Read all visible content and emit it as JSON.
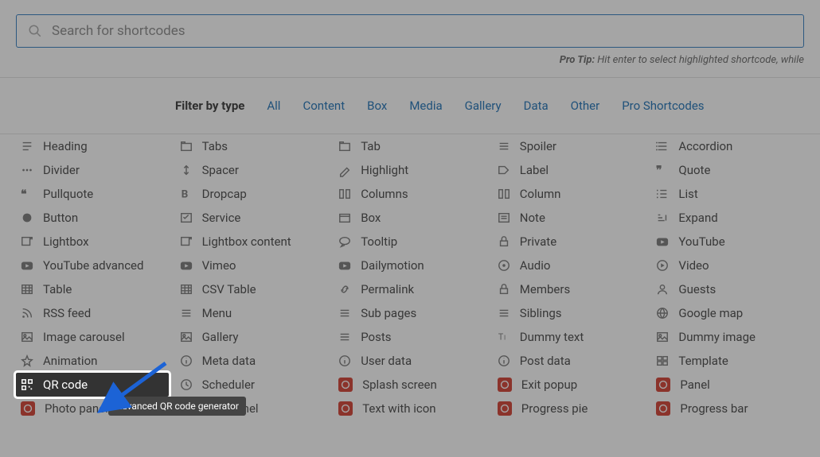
{
  "search": {
    "placeholder": "Search for shortcodes"
  },
  "protip": {
    "label": "Pro Tip:",
    "text": " Hit enter to select highlighted shortcode, while "
  },
  "filter": {
    "label": "Filter by type",
    "links": [
      "All",
      "Content",
      "Box",
      "Media",
      "Gallery",
      "Data",
      "Other",
      "Pro Shortcodes"
    ]
  },
  "tooltip": "Advanced QR code generator",
  "items": [
    {
      "icon": "heading",
      "label": "Heading"
    },
    {
      "icon": "tabs",
      "label": "Tabs"
    },
    {
      "icon": "tab",
      "label": "Tab"
    },
    {
      "icon": "spoiler",
      "label": "Spoiler"
    },
    {
      "icon": "accordion",
      "label": "Accordion"
    },
    {
      "icon": "divider",
      "label": "Divider"
    },
    {
      "icon": "spacer",
      "label": "Spacer"
    },
    {
      "icon": "highlight",
      "label": "Highlight"
    },
    {
      "icon": "label",
      "label": "Label"
    },
    {
      "icon": "quote",
      "label": "Quote"
    },
    {
      "icon": "pullquote",
      "label": "Pullquote"
    },
    {
      "icon": "dropcap",
      "label": "Dropcap"
    },
    {
      "icon": "columns",
      "label": "Columns"
    },
    {
      "icon": "column",
      "label": "Column"
    },
    {
      "icon": "list",
      "label": "List"
    },
    {
      "icon": "button",
      "label": "Button"
    },
    {
      "icon": "service",
      "label": "Service"
    },
    {
      "icon": "box",
      "label": "Box"
    },
    {
      "icon": "note",
      "label": "Note"
    },
    {
      "icon": "expand",
      "label": "Expand"
    },
    {
      "icon": "lightbox",
      "label": "Lightbox"
    },
    {
      "icon": "lightbox",
      "label": "Lightbox content"
    },
    {
      "icon": "tooltip",
      "label": "Tooltip"
    },
    {
      "icon": "private",
      "label": "Private"
    },
    {
      "icon": "youtube",
      "label": "YouTube"
    },
    {
      "icon": "youtube",
      "label": "YouTube advanced"
    },
    {
      "icon": "vimeo",
      "label": "Vimeo"
    },
    {
      "icon": "dailymotion",
      "label": "Dailymotion"
    },
    {
      "icon": "audio",
      "label": "Audio"
    },
    {
      "icon": "video",
      "label": "Video"
    },
    {
      "icon": "table",
      "label": "Table"
    },
    {
      "icon": "table",
      "label": "CSV Table"
    },
    {
      "icon": "permalink",
      "label": "Permalink"
    },
    {
      "icon": "members",
      "label": "Members"
    },
    {
      "icon": "guests",
      "label": "Guests"
    },
    {
      "icon": "rss",
      "label": "RSS feed"
    },
    {
      "icon": "menu",
      "label": "Menu"
    },
    {
      "icon": "menu",
      "label": "Sub pages"
    },
    {
      "icon": "menu",
      "label": "Siblings"
    },
    {
      "icon": "map",
      "label": "Google map"
    },
    {
      "icon": "image",
      "label": "Image carousel"
    },
    {
      "icon": "image",
      "label": "Gallery"
    },
    {
      "icon": "menu",
      "label": "Posts"
    },
    {
      "icon": "dummytext",
      "label": "Dummy text"
    },
    {
      "icon": "image",
      "label": "Dummy image"
    },
    {
      "icon": "animation",
      "label": "Animation"
    },
    {
      "icon": "info",
      "label": "Meta data"
    },
    {
      "icon": "info",
      "label": "User data"
    },
    {
      "icon": "info",
      "label": "Post data"
    },
    {
      "icon": "template",
      "label": "Template"
    },
    {
      "icon": "qr",
      "label": "QR code",
      "hl": true
    },
    {
      "icon": "clock",
      "label": "Scheduler"
    },
    {
      "icon": "pro",
      "label": "Splash screen",
      "pro": true
    },
    {
      "icon": "pro",
      "label": "Exit popup",
      "pro": true
    },
    {
      "icon": "pro",
      "label": "Panel",
      "pro": true
    },
    {
      "icon": "pro",
      "label": "Photo panel",
      "pro": true
    },
    {
      "icon": "pro",
      "label": "Icon panel",
      "pro": true
    },
    {
      "icon": "pro",
      "label": "Text with icon",
      "pro": true
    },
    {
      "icon": "pro",
      "label": "Progress pie",
      "pro": true
    },
    {
      "icon": "pro",
      "label": "Progress bar",
      "pro": true
    }
  ]
}
